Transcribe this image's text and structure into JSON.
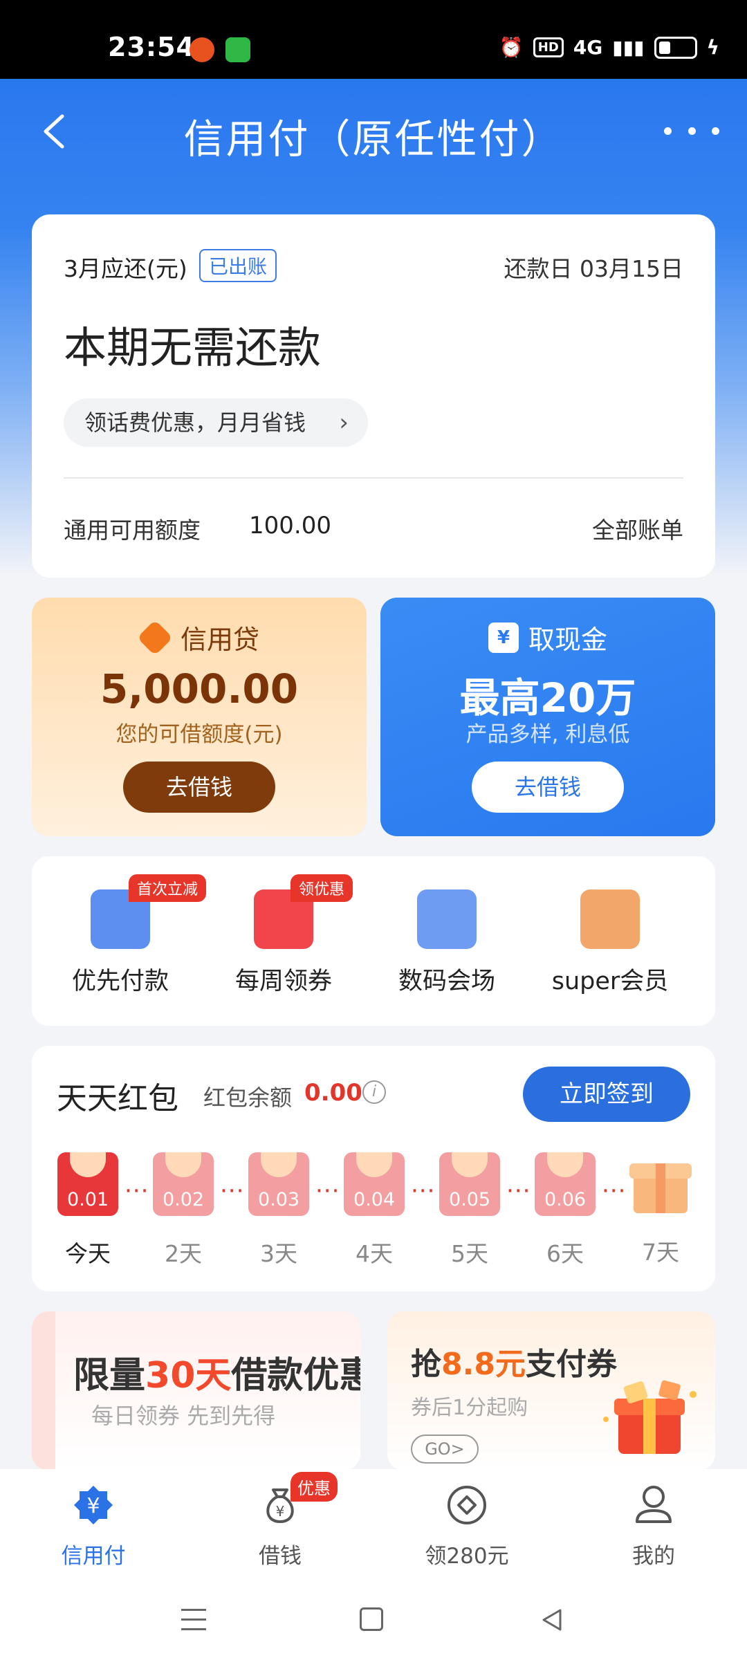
{
  "status_bar": {
    "time": "23:54",
    "hd": "HD",
    "signal": "4G"
  },
  "header": {
    "title": "信用付（原任性付）"
  },
  "bill": {
    "month_label": "3月应还(元)",
    "badge": "已出账",
    "due_date": "还款日 03月15日",
    "status": "本期无需还款",
    "promo": "领话费优惠，月月省钱",
    "limit_label": "通用可用额度",
    "limit_value": "100.00",
    "all_bills": "全部账单"
  },
  "loans": {
    "left": {
      "title": "信用贷",
      "amount": "5,000.00",
      "sub": "您的可借额度(元)",
      "button": "去借钱"
    },
    "right": {
      "title": "取现金",
      "amount": "最高20万",
      "sub": "产品多样, 利息低",
      "button": "去借钱",
      "icon": "¥"
    }
  },
  "shortcuts": [
    {
      "label": "优先付款",
      "tag": "首次立减",
      "icon": "wallet-icon"
    },
    {
      "label": "每周领券",
      "tag": "领优惠",
      "icon": "red-envelope-icon"
    },
    {
      "label": "数码会场",
      "tag": "",
      "icon": "tablet-icon"
    },
    {
      "label": "super会员",
      "tag": "",
      "icon": "crown-icon"
    }
  ],
  "red_packet": {
    "title": "天天红包",
    "balance_label": "红包余额",
    "balance_value": "0.00",
    "info_icon": "i",
    "button": "立即签到",
    "days": [
      {
        "label": "今天",
        "amount": "0.01"
      },
      {
        "label": "2天",
        "amount": "0.02"
      },
      {
        "label": "3天",
        "amount": "0.03"
      },
      {
        "label": "4天",
        "amount": "0.04"
      },
      {
        "label": "5天",
        "amount": "0.05"
      },
      {
        "label": "6天",
        "amount": "0.06"
      },
      {
        "label": "7天",
        "amount": ""
      }
    ],
    "dots": "···"
  },
  "banners": {
    "left": {
      "title_pre": "限量",
      "title_hl": "30天",
      "title_post": "借款优惠",
      "sub": "每日领券 先到先得"
    },
    "right": {
      "title_pre": "抢",
      "title_hl": "8.8元",
      "title_post": "支付券",
      "sub": "券后1分起购",
      "go": "GO>"
    }
  },
  "tabs": [
    {
      "label": "信用付",
      "icon": "credit-pay-icon",
      "active": true
    },
    {
      "label": "借钱",
      "icon": "money-bag-icon",
      "badge": "优惠"
    },
    {
      "label": "领280元",
      "icon": "diamond-coin-icon"
    },
    {
      "label": "我的",
      "icon": "profile-icon"
    }
  ],
  "colors": {
    "primary": "#2a78ee",
    "accent_red": "#e2362b",
    "loan_brown": "#7f3b0b"
  }
}
